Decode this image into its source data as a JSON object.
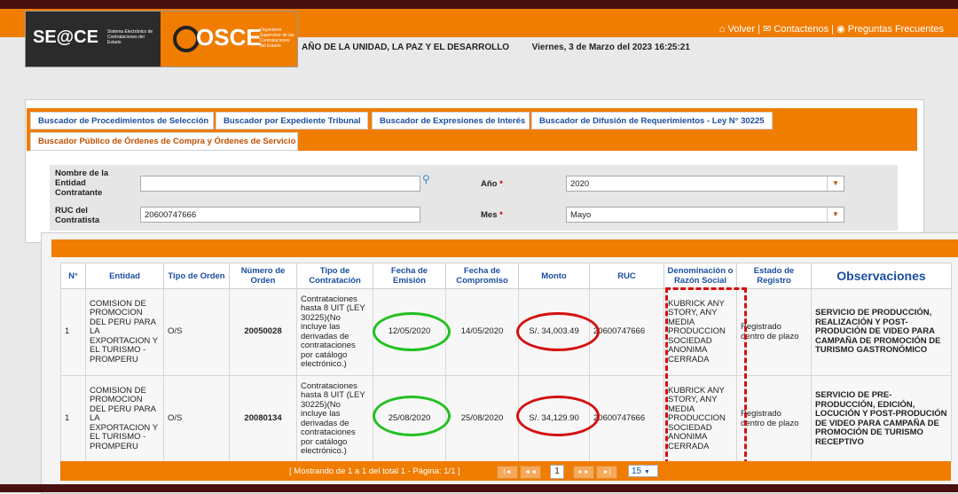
{
  "header": {
    "nav": {
      "volver": "Volver",
      "contactenos": "Contactenos",
      "preguntas": "Preguntas Frecuentes"
    },
    "logo_seace": "SE@CE",
    "logo_seace_sub": "Sistema Electrónico de Contrataciones del Estado",
    "logo_osce": "OSCE",
    "logo_osce_sub": "Organismo Supervisor de las Contrataciones del Estado",
    "year_motto": "AÑO DE LA UNIDAD, LA PAZ Y EL DESARROLLO",
    "datetime": "Viernes, 3 de Marzo del 2023 16:25:21"
  },
  "tabs": [
    "Buscador de Procedimientos de Selección",
    "Buscador por Expediente Tribunal",
    "Buscador de Expresiones de Interés",
    "Buscador de Difusión de Requerimientos - Ley N° 30225",
    "Buscador Público de Órdenes de Compra y Órdenes de Servicio"
  ],
  "form": {
    "entidad_label": "Nombre de la Entidad Contratante",
    "entidad_value": "",
    "ruc_label": "RUC del Contratista",
    "ruc_value": "20600747666",
    "anio_label": "Año",
    "anio_value": "2020",
    "mes_label": "Mes",
    "mes_value": "Mayo",
    "required_mark": "*"
  },
  "table": {
    "headers": [
      "N°",
      "Entidad",
      "Tipo de Orden",
      "Número de Orden",
      "Tipo de Contratación",
      "Fecha de Emisión",
      "Fecha de Compromiso",
      "Monto",
      "RUC",
      "Denominación o Razón Social",
      "Estado de Registro",
      "Observaciones"
    ],
    "rows": [
      {
        "n": "1",
        "entidad": "COMISION DE PROMOCION DEL PERU PARA LA EXPORTACION Y EL TURISMO - PROMPERU",
        "tipo_orden": "O/S",
        "numero": "20050028",
        "tipo_contratacion": "Contrataciones hasta 8 UIT (LEY 30225)(No incluye las derivadas de contrataciones por catálogo electrónico.)",
        "fecha_emision": "12/05/2020",
        "fecha_compromiso": "14/05/2020",
        "monto": "S/. 34,003.49",
        "ruc": "20600747666",
        "razon_social": "KUBRICK ANY STORY, ANY MEDIA PRODUCCION SOCIEDAD ANONIMA CERRADA",
        "estado": "Registrado dentro de plazo",
        "observaciones": "SERVICIO DE PRODUCCIÓN, REALIZACIÓN Y POST-PRODUCIÓN DE VIDEO PARA CAMPAÑA DE PROMOCIÓN DE TURISMO GASTRONÓMICO"
      },
      {
        "n": "1",
        "entidad": "COMISION DE PROMOCION DEL PERU PARA LA EXPORTACION Y EL TURISMO - PROMPERU",
        "tipo_orden": "O/S",
        "numero": "20080134",
        "tipo_contratacion": "Contrataciones hasta 8 UIT (LEY 30225)(No incluye las derivadas de contrataciones por catálogo electrónico.)",
        "fecha_emision": "25/08/2020",
        "fecha_compromiso": "25/08/2020",
        "monto": "S/. 34,129.90",
        "ruc": "20600747666",
        "razon_social": "KUBRICK ANY STORY, ANY MEDIA PRODUCCION SOCIEDAD ANONIMA CERRADA",
        "estado": "Registrado dentro de plazo",
        "observaciones": "SERVICIO DE PRE-PRODUCCIÓN, EDICIÓN, LOCUCIÓN Y POST-PRODUCIÓN DE VIDEO PARA CAMPAÑA DE PROMOCIÓN DE TURISMO RECEPTIVO"
      }
    ]
  },
  "pager": {
    "text": "[ Mostrando de 1 a 1 del total 1 - Página: 1/1 ]",
    "current_page": "1",
    "page_size": "15"
  },
  "colors": {
    "brand_orange": "#f07c00",
    "dark": "#4a1010",
    "link_blue": "#1a4fa0",
    "highlight_green": "#22c022",
    "highlight_red": "#d41010"
  }
}
